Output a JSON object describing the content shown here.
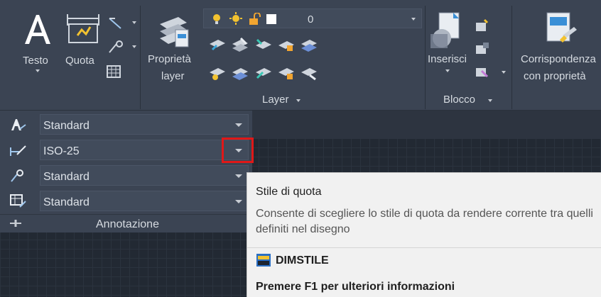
{
  "ribbon": {
    "testo_label": "Testo",
    "quota_label": "Quota",
    "proprieta_layer_label_1": "Proprietà",
    "proprieta_layer_label_2": "layer",
    "layer_combo_value": "0",
    "layer_panel_label": "Layer",
    "inserisci_label": "Inserisci",
    "blocco_panel_label": "Blocco",
    "corrispondenza_label_1": "Corrispondenza",
    "corrispondenza_label_2": "con proprietà"
  },
  "annotation": {
    "rows": [
      {
        "value": "Standard",
        "icon": "text-style-icon"
      },
      {
        "value": "ISO-25",
        "icon": "dimension-style-icon"
      },
      {
        "value": "Standard",
        "icon": "multileader-style-icon"
      },
      {
        "value": "Standard",
        "icon": "table-style-icon"
      }
    ],
    "panel_title": "Annotazione"
  },
  "tooltip": {
    "title": "Stile di quota",
    "description": "Consente di scegliere lo stile di quota da rendere corrente tra quelli definiti nel disegno",
    "command": "DIMSTILE",
    "help": "Premere F1 per ulteriori informazioni"
  },
  "colors": {
    "ribbon_bg": "#3b4453",
    "canvas_bg": "#222933",
    "highlight": "#e01818",
    "tooltip_bg": "#f1f1f1"
  }
}
